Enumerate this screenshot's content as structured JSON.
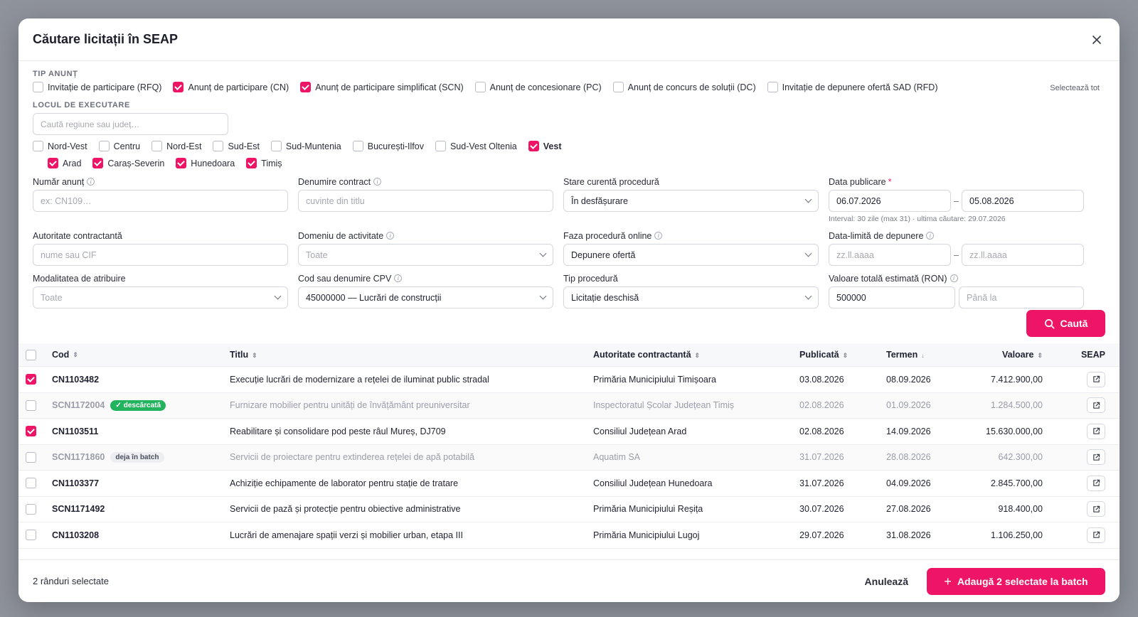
{
  "title": "Căutare licitații în SEAP",
  "tip_anunt": {
    "label": "TIP ANUNȚ",
    "select_all": "Selectează tot",
    "options": [
      {
        "label": "Invitație de participare (RFQ)",
        "checked": false
      },
      {
        "label": "Anunț de participare (CN)",
        "checked": true
      },
      {
        "label": "Anunț de participare simplificat (SCN)",
        "checked": true
      },
      {
        "label": "Anunț de concesionare (PC)",
        "checked": false
      },
      {
        "label": "Anunț de concurs de soluții (DC)",
        "checked": false
      },
      {
        "label": "Invitație de depunere ofertă SAD (RFD)",
        "checked": false
      }
    ]
  },
  "locul": {
    "label": "LOCUL DE EXECUTARE",
    "search_placeholder": "Caută regiune sau județ…",
    "regions": [
      {
        "label": "Nord-Vest",
        "checked": false
      },
      {
        "label": "Centru",
        "checked": false
      },
      {
        "label": "Nord-Est",
        "checked": false
      },
      {
        "label": "Sud-Est",
        "checked": false
      },
      {
        "label": "Sud-Muntenia",
        "checked": false
      },
      {
        "label": "București-Ilfov",
        "checked": false
      },
      {
        "label": "Sud-Vest Oltenia",
        "checked": false
      },
      {
        "label": "Vest",
        "checked": true
      }
    ],
    "counties": [
      {
        "label": "Arad",
        "checked": true
      },
      {
        "label": "Caraș-Severin",
        "checked": true
      },
      {
        "label": "Hunedoara",
        "checked": true
      },
      {
        "label": "Timiș",
        "checked": true
      }
    ]
  },
  "fields": {
    "numar_anunt": {
      "label": "Număr anunț",
      "placeholder": "ex: CN109…"
    },
    "denumire_contract": {
      "label": "Denumire contract",
      "placeholder": "cuvinte din titlu"
    },
    "stare": {
      "label": "Stare curentă procedură",
      "value": "În desfășurare"
    },
    "data_publicare": {
      "label": "Data publicare",
      "required": "*",
      "from": "06.07.2026",
      "to": "05.08.2026",
      "hint": "Interval: 30 zile (max 31) · ultima căutare: 29.07.2026"
    },
    "autoritate": {
      "label": "Autoritate contractantă",
      "placeholder": "nume sau CIF"
    },
    "domeniu": {
      "label": "Domeniu de activitate",
      "value": "Toate"
    },
    "faza": {
      "label": "Faza procedură online",
      "value": "Depunere ofertă"
    },
    "data_limita": {
      "label": "Data-limită de depunere",
      "from_placeholder": "zz.ll.aaaa",
      "to_placeholder": "zz.ll.aaaa"
    },
    "modalitate": {
      "label": "Modalitatea de atribuire",
      "value": "Toate"
    },
    "cpv": {
      "label": "Cod sau denumire CPV",
      "value": "45000000 — Lucrări de construcții"
    },
    "tip_procedura": {
      "label": "Tip procedură",
      "value": "Licitație deschisă"
    },
    "valoare": {
      "label": "Valoare totală estimată (RON)",
      "from": "500000",
      "to_placeholder": "Până la"
    }
  },
  "search_button": "Caută",
  "table": {
    "columns": [
      "Cod",
      "Titlu",
      "Autoritate contractantă",
      "Publicată",
      "Termen",
      "Valoare",
      "SEAP"
    ],
    "rows": [
      {
        "checked": true,
        "dim": false,
        "code": "CN1103482",
        "badge": "",
        "title": "Execuție lucrări de modernizare a rețelei de iluminat public stradal",
        "authority": "Primăria Municipiului Timișoara",
        "published": "03.08.2026",
        "deadline": "08.09.2026",
        "value": "7.412.900,00"
      },
      {
        "checked": false,
        "dim": true,
        "code": "SCN1172004",
        "badge": "descărcată",
        "badge_type": "green",
        "title": "Furnizare mobilier pentru unități de învățământ preuniversitar",
        "authority": "Inspectoratul Școlar Județean Timiș",
        "published": "02.08.2026",
        "deadline": "01.09.2026",
        "value": "1.284.500,00"
      },
      {
        "checked": true,
        "dim": false,
        "code": "CN1103511",
        "badge": "",
        "title": "Reabilitare și consolidare pod peste râul Mureș, DJ709",
        "authority": "Consiliul Județean Arad",
        "published": "02.08.2026",
        "deadline": "14.09.2026",
        "value": "15.630.000,00"
      },
      {
        "checked": false,
        "dim": true,
        "code": "SCN1171860",
        "badge": "deja în batch",
        "badge_type": "gray",
        "title": "Servicii de proiectare pentru extinderea rețelei de apă potabilă",
        "authority": "Aquatim SA",
        "published": "31.07.2026",
        "deadline": "28.08.2026",
        "value": "642.300,00"
      },
      {
        "checked": false,
        "dim": false,
        "code": "CN1103377",
        "badge": "",
        "title": "Achiziție echipamente de laborator pentru stație de tratare",
        "authority": "Consiliul Județean Hunedoara",
        "published": "31.07.2026",
        "deadline": "04.09.2026",
        "value": "2.845.700,00"
      },
      {
        "checked": false,
        "dim": false,
        "code": "SCN1171492",
        "badge": "",
        "title": "Servicii de pază și protecție pentru obiective administrative",
        "authority": "Primăria Municipiului Reșița",
        "published": "30.07.2026",
        "deadline": "27.08.2026",
        "value": "918.400,00"
      },
      {
        "checked": false,
        "dim": false,
        "code": "CN1103208",
        "badge": "",
        "title": "Lucrări de amenajare spații verzi și mobilier urban, etapa III",
        "authority": "Primăria Municipiului Lugoj",
        "published": "29.07.2026",
        "deadline": "31.08.2026",
        "value": "1.106.250,00"
      }
    ]
  },
  "footer": {
    "selected_count": "2 rânduri selectate",
    "cancel": "Anulează",
    "add": "Adaugă 2 selectate la batch"
  },
  "colors": {
    "accent": "#ee1566",
    "success": "#22b35e"
  }
}
